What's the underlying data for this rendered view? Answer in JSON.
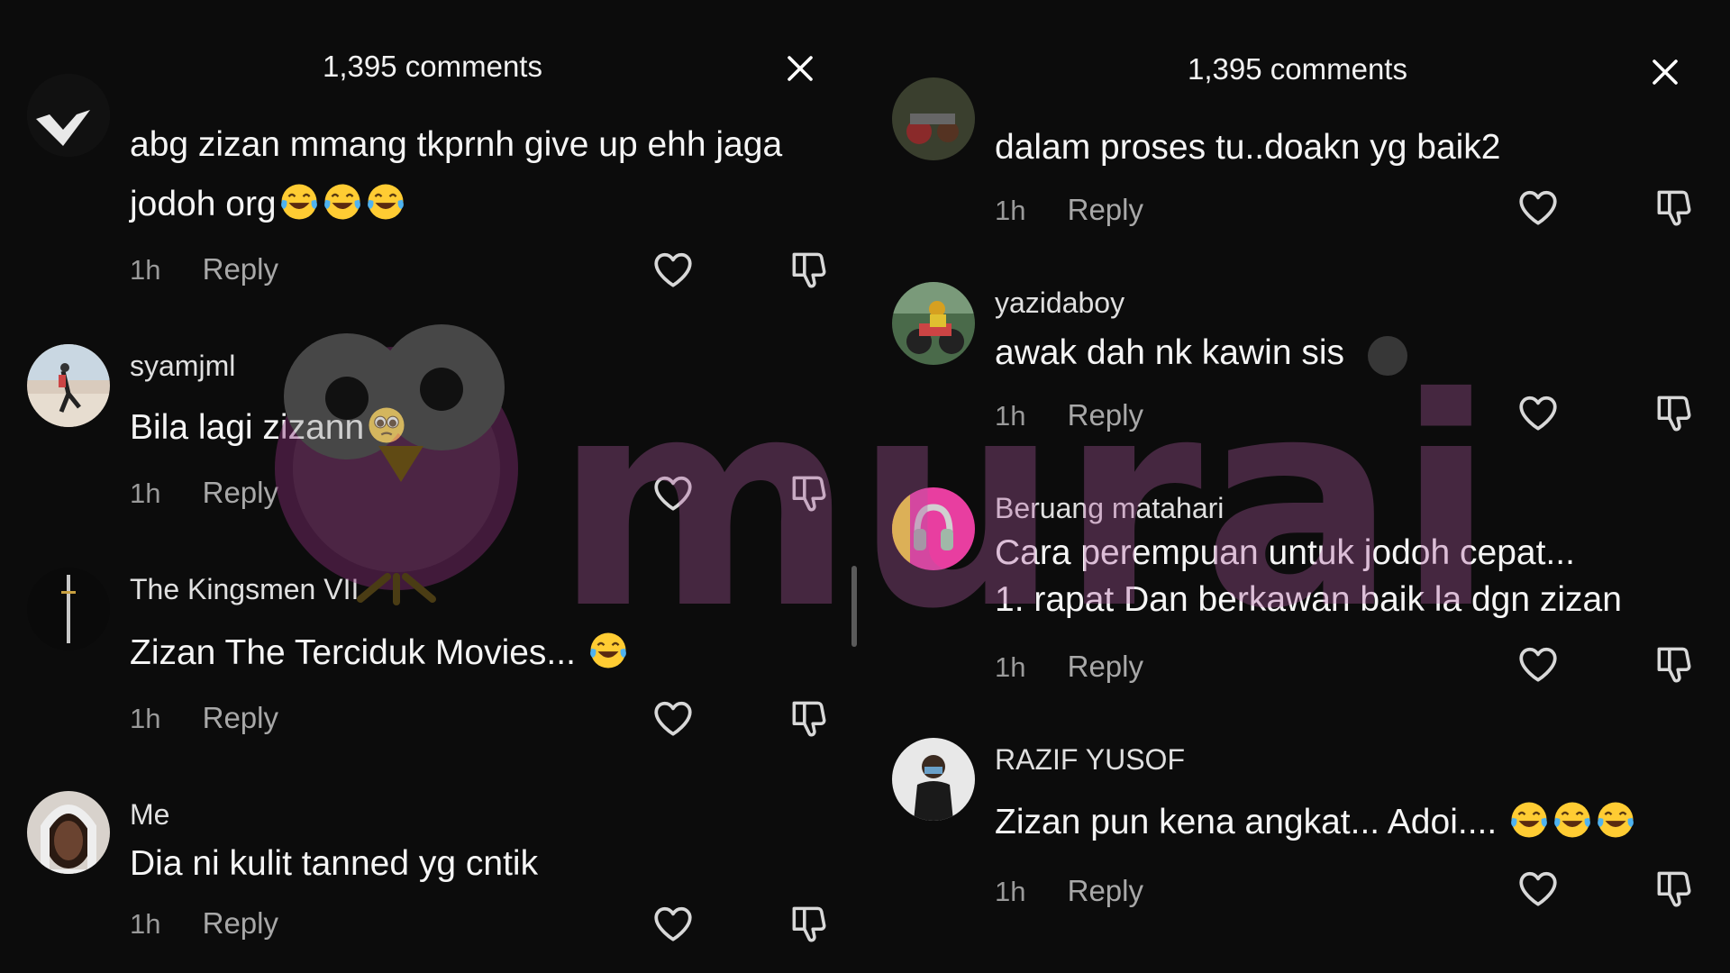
{
  "left_panel": {
    "header": "1,395 comments",
    "comments": [
      {
        "username": "",
        "text": "abg zizan mmang tkprnh give up ehh jaga jodoh org",
        "emoji_count": 3,
        "time": "1h",
        "reply": "Reply"
      },
      {
        "username": "syamjml",
        "text": "Bila lagi zizann",
        "emoji_count": 1,
        "time": "1h",
        "reply": "Reply"
      },
      {
        "username": "The Kingsmen VII",
        "text": "Zizan The Terciduk Movies...",
        "emoji_count": 1,
        "time": "1h",
        "reply": "Reply"
      },
      {
        "username": "Me",
        "text": "Dia ni kulit tanned yg cntik",
        "emoji_count": 0,
        "time": "1h",
        "reply": "Reply"
      }
    ]
  },
  "right_panel": {
    "header": "1,395 comments",
    "comments": [
      {
        "username": "",
        "text": "dalam proses tu..doakn yg baik2",
        "emoji_count": 0,
        "time": "1h",
        "reply": "Reply"
      },
      {
        "username": "yazidaboy",
        "text": "awak dah nk kawin sis",
        "emoji_count": 0,
        "time": "1h",
        "reply": "Reply"
      },
      {
        "username": "Beruang matahari",
        "text_line1": "Cara perempuan untuk jodoh cepat...",
        "text_line2": "1. rapat Dan berkawan baik la dgn zizan",
        "emoji_count": 0,
        "time": "1h",
        "reply": "Reply"
      },
      {
        "username": "RAZIF YUSOF",
        "text": "Zizan pun kena angkat... Adoi....",
        "emoji_count": 3,
        "time": "1h",
        "reply": "Reply"
      }
    ]
  },
  "watermark": "murai",
  "icons": {
    "close": "close-icon",
    "like": "heart-icon",
    "dislike": "thumbs-down-icon",
    "emoji_laugh": "tears-of-joy-emoji",
    "emoji_pleading": "pleading-face-emoji"
  },
  "colors": {
    "background": "#0c0c0c",
    "text_primary": "#f5f5f5",
    "text_secondary": "#9a9a9a",
    "watermark": "#b05aa0"
  }
}
